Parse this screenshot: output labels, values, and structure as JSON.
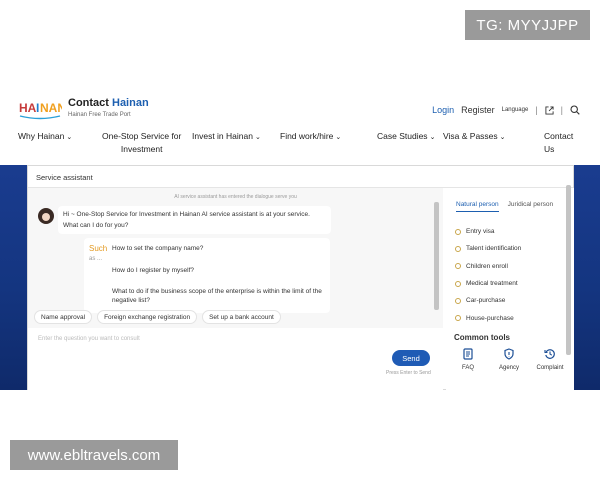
{
  "watermarks": {
    "top": "TG: MYYJJPP",
    "bottom": "www.ebltravels.com"
  },
  "header": {
    "title_part1": "Contact ",
    "title_part2": "Hainan",
    "subtitle": "Hainan Free Trade Port",
    "logo_text": "HAINAN",
    "login": "Login",
    "register": "Register",
    "language": "Language"
  },
  "nav": [
    {
      "label": "Why Hainan",
      "chevron": true
    },
    {
      "label": "One-Stop Service for\nInvestment",
      "chevron": false
    },
    {
      "label": "Invest in Hainan",
      "chevron": true
    },
    {
      "label": "Find work/hire",
      "chevron": true
    },
    {
      "label": "Case Studies",
      "chevron": true
    },
    {
      "label": "Visa & Passes",
      "chevron": true
    },
    {
      "label": "Contact Us",
      "chevron": false
    }
  ],
  "chat": {
    "panel_title": "Service assistant",
    "system_note": "AI service assistant has entered the dialogue serve you",
    "greeting": "Hi ~ One-Stop Service for Investment in Hainan AI service assistant is at your service. What can I do for you?",
    "such": "Such",
    "such_sub": "as ...",
    "questions": [
      "How to set the company name?",
      "How do I register by myself?",
      "What to do if the business scope of the enterprise is within the limit of the negative list?"
    ],
    "chips": [
      "Name approval",
      "Foreign exchange registration",
      "Set up a bank account"
    ],
    "input_placeholder": "Enter the question you want to consult",
    "send": "Send",
    "send_hint": "Press Enter to Send"
  },
  "side": {
    "tab_active": "Natural person",
    "tab_other": "Juridical person",
    "services": [
      "Entry visa",
      "Talent identification",
      "Children enroll",
      "Medical treatment",
      "Car-purchase",
      "House-purchase"
    ],
    "tools_title": "Common tools",
    "tools": [
      {
        "label": "FAQ",
        "icon": "document-icon"
      },
      {
        "label": "Agency",
        "icon": "shield-icon"
      },
      {
        "label": "Complaint",
        "icon": "history-icon"
      }
    ]
  },
  "colors": {
    "brand_blue": "#1d5fb0",
    "band_blue": "#143580",
    "send_blue": "#1f5bb5"
  }
}
